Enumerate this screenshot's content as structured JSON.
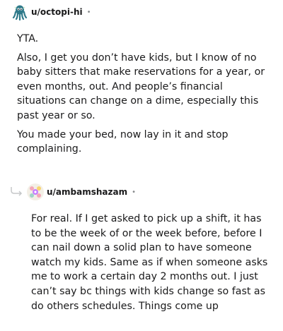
{
  "comments": [
    {
      "author": "u/octopi-hi",
      "separator": "•",
      "avatar_icon": "octopus-avatar-icon",
      "paragraphs": [
        "YTA.",
        "Also, I get you don’t have kids, but I know of no baby sitters that make reservations for a year, or even months, out. And people’s financial situations can change on a dime, especially this past year or so.",
        "You made your bed, now lay in it and stop complaining."
      ]
    },
    {
      "author": "u/ambamshazam",
      "separator": "•",
      "avatar_icon": "flower-avatar-icon",
      "reply_icon": "reply-arrow-icon",
      "paragraphs": [
        "For real. If I get asked to pick up a shift, it has to be the week of or the week before, before I can nail down a solid plan to have someone watch my kids. Same as if when someone asks me to work a certain day 2 months out. I just can’t say bc things with kids change so fast as do others schedules. Things come up"
      ]
    }
  ]
}
